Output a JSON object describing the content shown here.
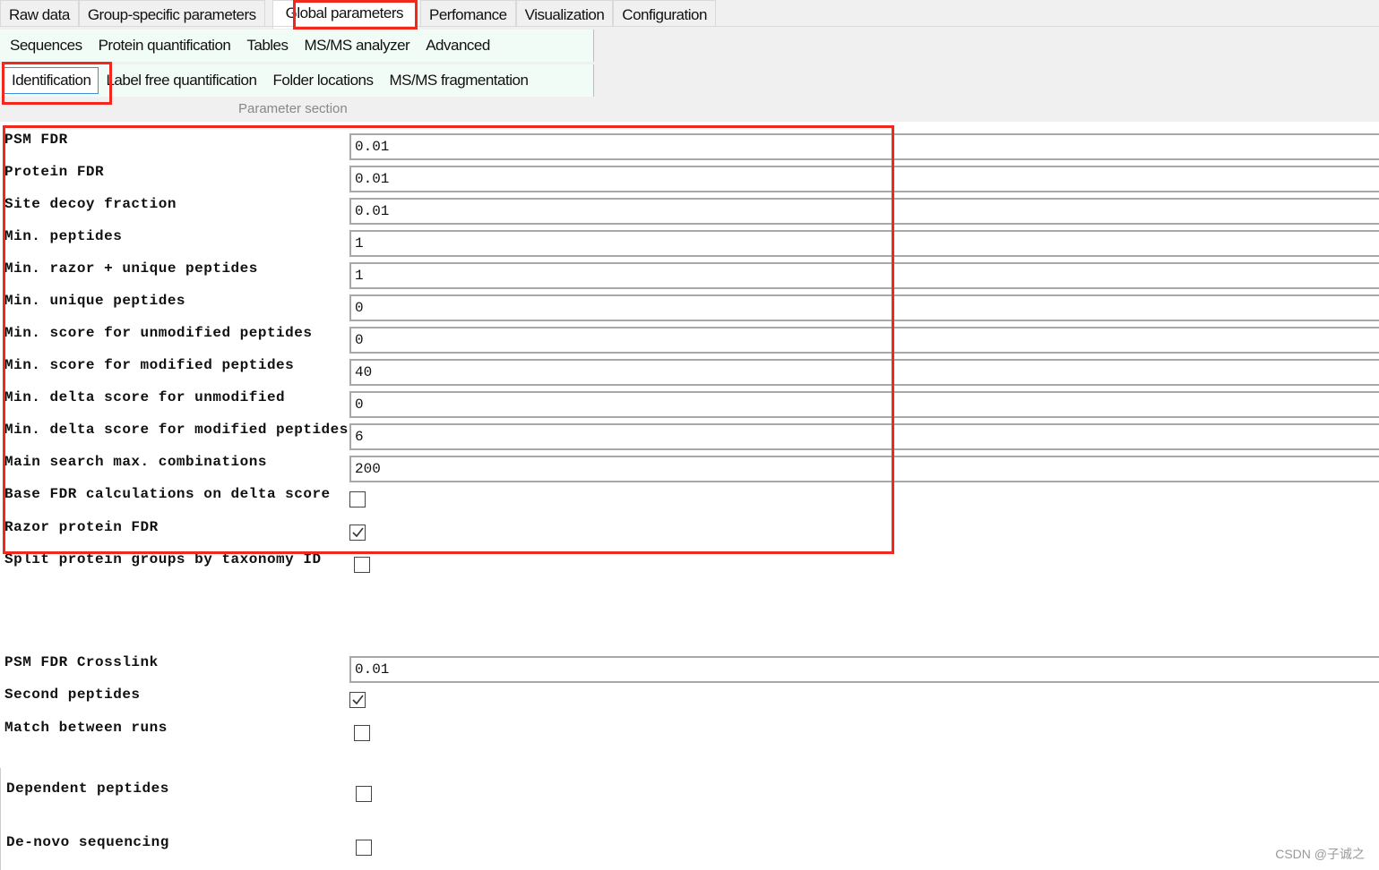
{
  "tabs": [
    "Raw data",
    "Group-specific parameters",
    "Global parameters",
    "Perfomance",
    "Visualization",
    "Configuration"
  ],
  "subtabs_row1": [
    "Sequences",
    "Protein quantification",
    "Tables",
    "MS/MS analyzer",
    "Advanced"
  ],
  "subtabs_row2": [
    "Identification",
    "Label free quantification",
    "Folder locations",
    "MS/MS fragmentation"
  ],
  "parameter_section": "Parameter section",
  "params": [
    {
      "label": "PSM FDR",
      "value": "0.01"
    },
    {
      "label": "Protein FDR",
      "value": "0.01"
    },
    {
      "label": "Site decoy fraction",
      "value": "0.01"
    },
    {
      "label": "Min. peptides",
      "value": "1"
    },
    {
      "label": "Min. razor + unique peptides",
      "value": "1"
    },
    {
      "label": "Min. unique peptides",
      "value": "0"
    },
    {
      "label": "Min. score for unmodified peptides",
      "value": "0"
    },
    {
      "label": "Min. score for modified peptides",
      "value": "40"
    },
    {
      "label": "Min. delta score for unmodified",
      "value": "0"
    },
    {
      "label": "Min. delta score for modified peptides",
      "value": "6"
    },
    {
      "label": "Main search max. combinations",
      "value": "200"
    },
    {
      "label": "Base FDR calculations on delta score",
      "checked": false
    },
    {
      "label": "Razor protein FDR",
      "checked": true
    },
    {
      "label": "Split protein groups by taxonomy ID",
      "checked": false
    },
    {
      "label": "PSM FDR Crosslink",
      "value": "0.01"
    },
    {
      "label": "Second peptides",
      "checked": true
    },
    {
      "label": "Match between runs",
      "checked": false
    },
    {
      "label": "Dependent peptides",
      "checked": false
    },
    {
      "label": "De-novo sequencing",
      "checked": false
    }
  ],
  "watermark": "CSDN @子诚之",
  "colors": {
    "highlight": "#f0281e",
    "subtab_bg": "#f2fcf7",
    "selected_border": "#3c8fd8"
  }
}
